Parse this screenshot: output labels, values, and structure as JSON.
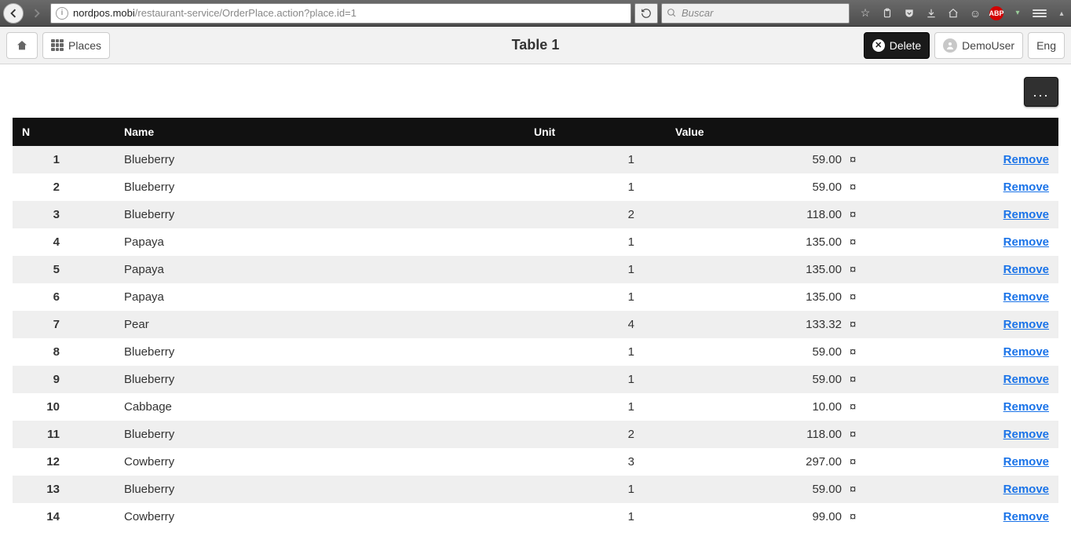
{
  "browser": {
    "url_host": "nordpos.mobi",
    "url_path": "/restaurant-service/OrderPlace.action?place.id=1",
    "search_placeholder": "Buscar"
  },
  "header": {
    "places_label": "Places",
    "title": "Table 1",
    "delete_label": "Delete",
    "user_label": "DemoUser",
    "lang_label": "Eng"
  },
  "more_label": "...",
  "table": {
    "columns": {
      "n": "N",
      "name": "Name",
      "unit": "Unit",
      "value": "Value"
    },
    "remove_label": "Remove",
    "currency": "¤",
    "rows": [
      {
        "n": "1",
        "name": "Blueberry",
        "unit": "1",
        "value": "59.00"
      },
      {
        "n": "2",
        "name": "Blueberry",
        "unit": "1",
        "value": "59.00"
      },
      {
        "n": "3",
        "name": "Blueberry",
        "unit": "2",
        "value": "118.00"
      },
      {
        "n": "4",
        "name": "Papaya",
        "unit": "1",
        "value": "135.00"
      },
      {
        "n": "5",
        "name": "Papaya",
        "unit": "1",
        "value": "135.00"
      },
      {
        "n": "6",
        "name": "Papaya",
        "unit": "1",
        "value": "135.00"
      },
      {
        "n": "7",
        "name": "Pear",
        "unit": "4",
        "value": "133.32"
      },
      {
        "n": "8",
        "name": "Blueberry",
        "unit": "1",
        "value": "59.00"
      },
      {
        "n": "9",
        "name": "Blueberry",
        "unit": "1",
        "value": "59.00"
      },
      {
        "n": "10",
        "name": "Cabbage",
        "unit": "1",
        "value": "10.00"
      },
      {
        "n": "11",
        "name": "Blueberry",
        "unit": "2",
        "value": "118.00"
      },
      {
        "n": "12",
        "name": "Cowberry",
        "unit": "3",
        "value": "297.00"
      },
      {
        "n": "13",
        "name": "Blueberry",
        "unit": "1",
        "value": "59.00"
      },
      {
        "n": "14",
        "name": "Cowberry",
        "unit": "1",
        "value": "99.00"
      }
    ]
  }
}
